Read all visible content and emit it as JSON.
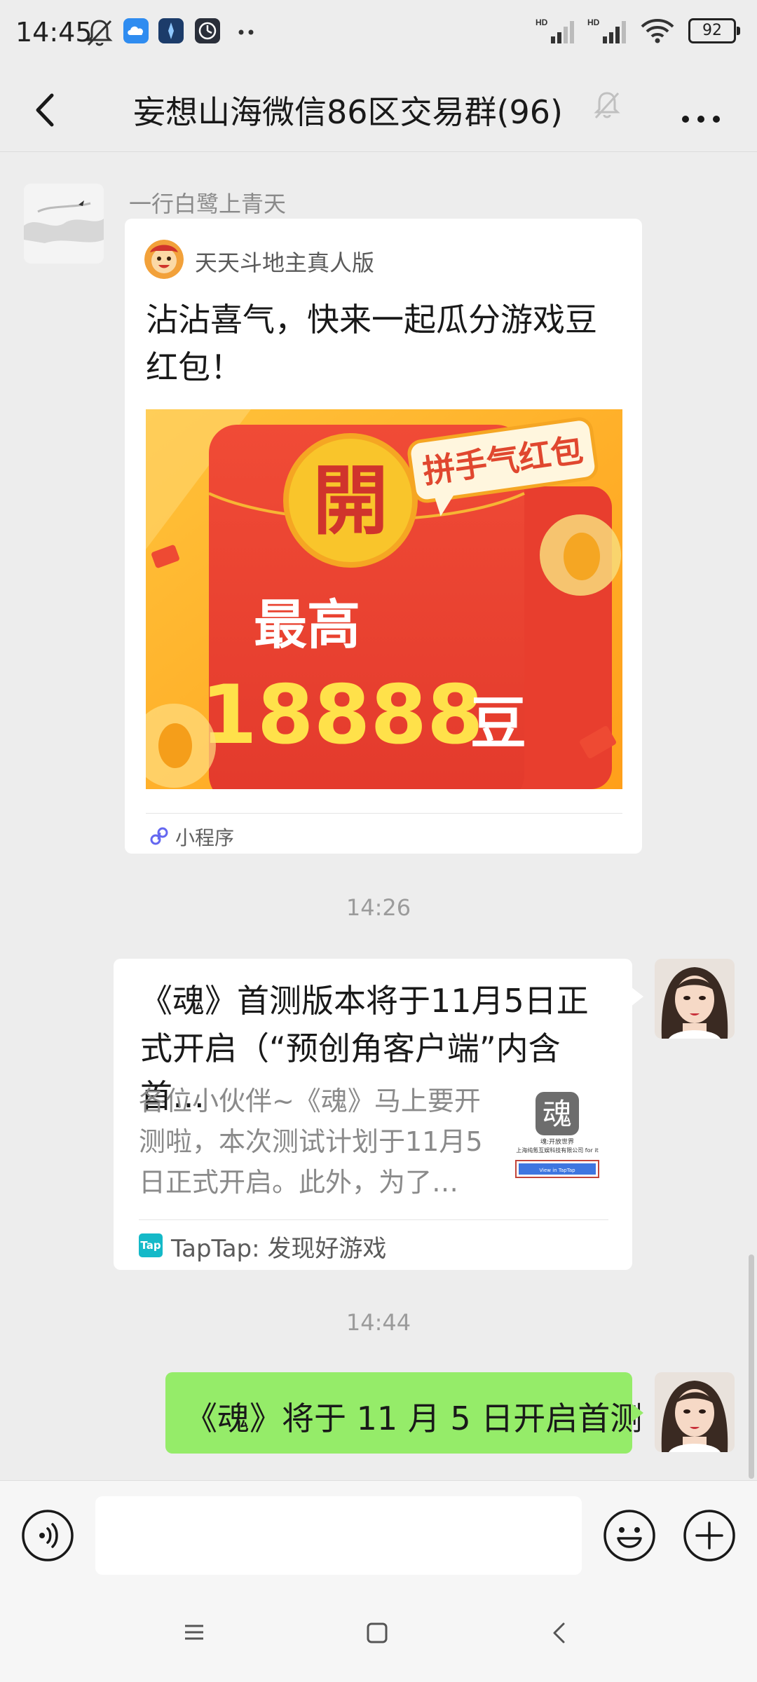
{
  "status_bar": {
    "time": "14:45",
    "battery": "92"
  },
  "header": {
    "title": "妄想山海微信86区交易群(96)"
  },
  "messages": {
    "mini_program": {
      "sender": "一行白鹭上青天",
      "source_name": "天天斗地主真人版",
      "title": "沾沾喜气，快来一起瓜分游戏豆红包！",
      "thumb": {
        "badge": "拼手气红包",
        "seal": "開",
        "line1": "最高",
        "amount": "18888",
        "unit": "豆"
      },
      "footer": "小程序"
    },
    "time1": "14:26",
    "link_card": {
      "title": "《魂》首测版本将于11月5日正式开启（“预创角客户端”内含首…",
      "desc": "各位小伙伴~《魂》马上要开测啦，本次测试计划于11月5日正式开启。此外，为了…",
      "source_name": "TapTap: 发现好游戏",
      "source_icon_text": "Tap",
      "thumb_title": "魂",
      "thumb_line1": "魂:开放世界",
      "thumb_line2": "上海纯氪互娱科技有限公司 for it",
      "thumb_button": "View in TapTap"
    },
    "time2": "14:44",
    "text_message": "《魂》将于 11 月 5 日开启首测"
  },
  "input": {
    "placeholder": ""
  }
}
